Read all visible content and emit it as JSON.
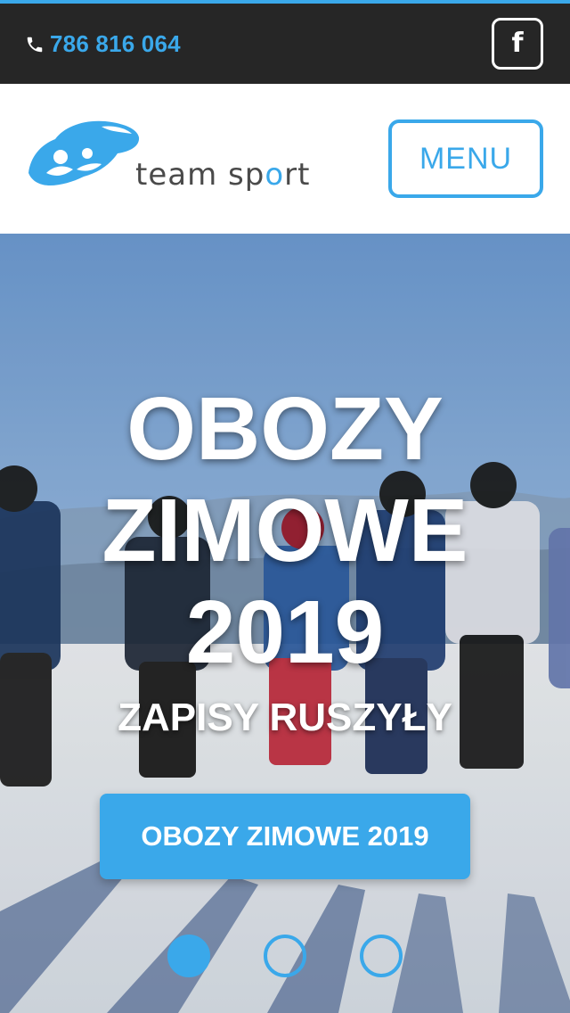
{
  "topbar": {
    "phone_icon": "phone-icon",
    "phone": "786 816 064",
    "facebook_icon": "facebook-icon",
    "facebook_glyph": "f"
  },
  "header": {
    "logo_text": "team sport",
    "menu_label": "MENU"
  },
  "hero": {
    "title_lines": [
      "OBOZY",
      "ZIMOWE",
      "2019"
    ],
    "subtitle": "ZAPISY RUSZYŁY",
    "cta_label": "OBOZY ZIMOWE 2019",
    "slides": [
      {
        "active": true
      },
      {
        "active": false
      },
      {
        "active": false
      }
    ]
  },
  "colors": {
    "accent": "#3aa8ea",
    "topbar": "#262626",
    "logo_text": "#4a4a4a"
  }
}
